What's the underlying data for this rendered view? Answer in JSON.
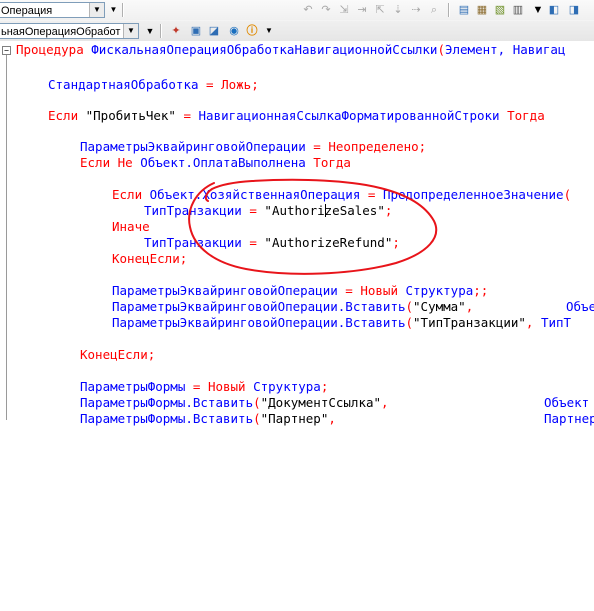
{
  "toolbar": {
    "combo_top": "Операция",
    "combo_bottom": "ьнаяОперацияОбработ",
    "icons": [
      "new-icon",
      "open-icon",
      "save-icon",
      "print-icon",
      "preview-icon",
      "find-icon",
      "info-icon",
      "undo-icon",
      "redo-icon",
      "cut-icon",
      "copy-icon",
      "paste-icon",
      "syntax-check-icon",
      "dropdown-icon"
    ]
  },
  "code": {
    "l1_kw": "Процедура",
    "l1_name": "ФискальнаяОперацияОбработкаНавигационнойСсылки",
    "l1_paren": "(",
    "l1_args": "Элемент, Навигац",
    "l2_id": "СтандартнаяОбработка",
    "l2_op": " = ",
    "l2_kw": "Ложь",
    "l2_end": ";",
    "l3_kw1": "Если",
    "l3_str": " \"ПробитьЧек\"",
    "l3_op": " = ",
    "l3_id": "НавигационнаяСсылкаФорматированнойСтроки",
    "l3_kw2": " Тогда",
    "l4_id": "ПараметрыЭквайринговойОперации",
    "l4_op": " = ",
    "l4_kw": "Неопределено",
    "l4_end": ";",
    "l5_kw1": "Если Не",
    "l5_id": " Объект.ОплатаВыполнена",
    "l5_kw2": " Тогда",
    "l6_kw": "Если",
    "l6_id": " Объект.ХозяйственнаяОперация",
    "l6_op": " = ",
    "l6_id2": "ПредопределенноеЗначение",
    "l6_end": "(",
    "l7_id": "ТипТранзакции",
    "l7_op": " = ",
    "l7_str_a": "\"Authori",
    "l7_str_b": "zeSales\"",
    "l7_end": ";",
    "l8_kw": "Иначе",
    "l9_id": "ТипТранзакции",
    "l9_op": " = ",
    "l9_str": "\"AuthorizeRefund\"",
    "l9_end": ";",
    "l10_kw": "КонецЕсли;",
    "l11_id": "ПараметрыЭквайринговойОперации",
    "l11_op": " = ",
    "l11_kw": "Новый",
    "l11_id2": " Структура",
    "l11_end": ";;",
    "l12_id": "ПараметрыЭквайринговойОперации.Вставить",
    "l12_paren": "(",
    "l12_str": "\"Сумма\"",
    "l12_comma": ",",
    "l12_tail": "Объе",
    "l13_id": "ПараметрыЭквайринговойОперации.Вставить",
    "l13_paren": "(",
    "l13_str": "\"ТипТранзакции\"",
    "l13_comma": ",",
    "l13_tail": " ТипТ",
    "l14_kw": "КонецЕсли;",
    "l15_id": "ПараметрыФормы",
    "l15_op": " = ",
    "l15_kw": "Новый",
    "l15_id2": " Структура",
    "l15_end": ";",
    "l16_id": "ПараметрыФормы.Вставить",
    "l16_paren": "(",
    "l16_str": "\"ДокументСсылка\"",
    "l16_comma": ",",
    "l16_tail": "Объект",
    "l17_id": "ПараметрыФормы.Вставить",
    "l17_paren": "(",
    "l17_str": "\"Партнер\"",
    "l17_comma": ",",
    "l17_tail": "Партнер"
  },
  "colors": {
    "keyword": "#ff0000",
    "identifier": "#0000ff",
    "string": "#000000",
    "annotation": "#e8141a"
  }
}
